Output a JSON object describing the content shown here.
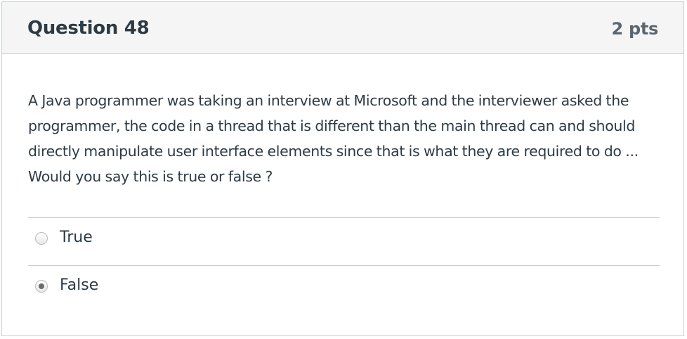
{
  "question": {
    "title": "Question 48",
    "points": "2 pts",
    "text": "A Java programmer was taking an interview at Microsoft and the interviewer asked the programmer, the code in a thread that is different than the main thread can and should directly manipulate user interface elements since that is what they are required to do ... Would you say this is true or false ?"
  },
  "answers": [
    {
      "label": "True",
      "selected": false
    },
    {
      "label": "False",
      "selected": true
    }
  ],
  "colors": {
    "header_background": "#f5f5f5",
    "border": "#c7cdd1",
    "text": "#2d3b45",
    "selected_dot": "#6b6b6b"
  }
}
